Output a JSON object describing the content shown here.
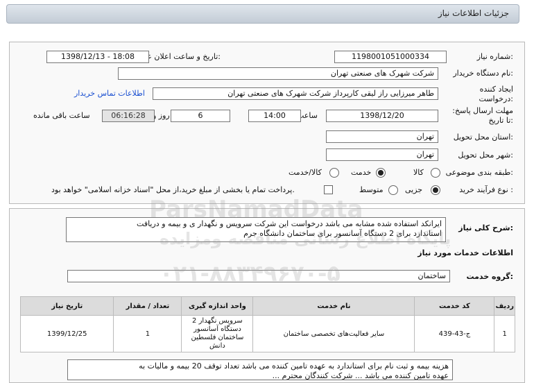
{
  "header": {
    "title": "جزئیات اطلاعات نیاز"
  },
  "form": {
    "need_number_label": "شماره نیاز:",
    "need_number": "1198001051000334",
    "announce_label": "تاریخ و ساعت اعلان عمومی:",
    "announce_value": "1398/12/13 - 18:08",
    "buyer_org_label": "نام دستگاه خریدار:",
    "buyer_org": "شرکت شهرک های صنعتی تهران",
    "creator_label": "ایجاد کننده درخواست:",
    "creator": "طاهر  میرزایی راز لیقی کارپرداز  شرکت شهرک های صنعتی تهران",
    "contact_link": "اطلاعات تماس خریدار",
    "deadline_label": "مهلت ارسال پاسخ: تا تاریخ:",
    "deadline_date": "1398/12/20",
    "time_label": "ساعت",
    "deadline_time": "14:00",
    "days_value": "6",
    "days_label": "روز و",
    "remaining_time": "06:16:28",
    "remaining_label": "ساعت باقی مانده",
    "province_label": "استان محل تحویل:",
    "province": "تهران",
    "city_label": "شهر محل تحویل:",
    "city": "تهران",
    "category_label": "طبقه بندی موضوعی:",
    "category_options": [
      "کالا",
      "خدمت",
      "کالا/خدمت"
    ],
    "process_label": "نوع فرآیند خرید :",
    "process_options": [
      "جزیی",
      "متوسط"
    ],
    "payment_note": "پرداخت تمام یا بخشی از مبلغ خرید،از محل \"اسناد خزانه اسلامی\" خواهد بود."
  },
  "description": {
    "label": "شرح کلی نیاز:",
    "text": "ایرانکد استفاده شده مشابه می باشد   درخواست این شرکت  سرویس و نگهدار ی و بیمه و دریافت\nاستاندارد برای 2 دستگاه آسانسور  برای ساختمان دانشگاه جرم"
  },
  "services": {
    "section_title": "اطلاعات خدمات مورد نیاز",
    "group_label": "گروه خدمت:",
    "group_value": "ساختمان",
    "columns": [
      "ردیف",
      "کد خدمت",
      "نام خدمت",
      "واحد اندازه گیری",
      "تعداد / مقدار",
      "تاریخ نیاز"
    ],
    "rows": [
      {
        "row": "1",
        "code": "ج-43-439",
        "name": "سایر فعالیت‌های تخصصی ساختمان",
        "unit": "سرویس نگهدار 2 دستگاه آسانسور ساختمان فلسطین دانش",
        "qty": "1",
        "date": "1399/12/25"
      }
    ]
  },
  "buyer_notes": {
    "text": "هزینه بیمه و ثبت نام برای استاندارد به عهده تامین کننده می باشد  تعداد توقف 20 بیمه و مالیات به\nعهده تامین کننده می باشد ...   شرکت کنندگان محترم ..."
  },
  "watermark": {
    "line1": "ParsNamadData",
    "line2": "پایگاه اطلاع رسانی مناقصه ومزایده",
    "line3": "۰۲۱-۸۸۳۴۹۶۷۰-۵"
  }
}
